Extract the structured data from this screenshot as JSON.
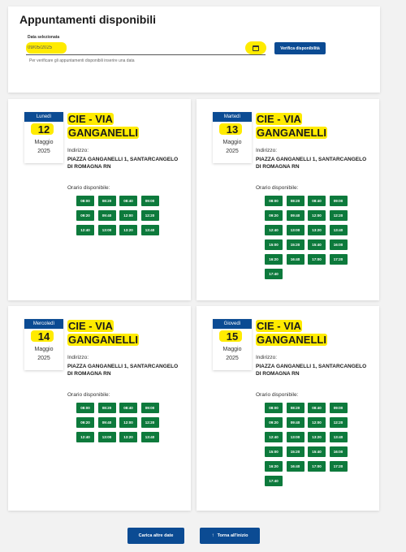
{
  "header": {
    "title": "Appuntamenti disponibili",
    "date_label": "Data selezionata",
    "date_value": "09/05/2025",
    "verify_label": "Verifica disponibilità",
    "hint": "Per verificare gli appuntamenti disponibili inserire una data"
  },
  "cards": [
    {
      "weekday": "Lunedì",
      "day": "12",
      "month": "Maggio",
      "year": "2025",
      "name_line1": "CIE - VIA",
      "name_line2": "GANGANELLI",
      "address_label": "Indirizzo:",
      "address": "PIAZZA GANGANELLI 1, SANTARCANGELO DI ROMAGNA RN",
      "time_label": "Orario disponibile:",
      "slots": [
        "08:00",
        "08:20",
        "08:40",
        "09:00",
        "09:20",
        "09:40",
        "12:00",
        "12:20",
        "12:40",
        "13:00",
        "13:20",
        "13:40"
      ]
    },
    {
      "weekday": "Martedì",
      "day": "13",
      "month": "Maggio",
      "year": "2025",
      "name_line1": "CIE - VIA",
      "name_line2": "GANGANELLI",
      "address_label": "Indirizzo:",
      "address": "PIAZZA GANGANELLI 1, SANTARCANGELO DI ROMAGNA RN",
      "time_label": "Orario disponibile:",
      "slots": [
        "08:00",
        "08:20",
        "08:40",
        "09:00",
        "09:20",
        "09:40",
        "12:00",
        "12:20",
        "12:40",
        "13:00",
        "13:20",
        "13:40",
        "15:00",
        "15:20",
        "15:40",
        "16:00",
        "16:20",
        "16:40",
        "17:00",
        "17:20",
        "17:40"
      ]
    },
    {
      "weekday": "Mercoledì",
      "day": "14",
      "month": "Maggio",
      "year": "2025",
      "name_line1": "CIE - VIA",
      "name_line2": "GANGANELLI",
      "address_label": "Indirizzo:",
      "address": "PIAZZA GANGANELLI 1, SANTARCANGELO DI ROMAGNA RN",
      "time_label": "Orario disponibile:",
      "slots": [
        "08:00",
        "08:20",
        "08:40",
        "09:00",
        "09:20",
        "09:40",
        "12:00",
        "12:20",
        "12:40",
        "13:00",
        "13:20",
        "13:40"
      ]
    },
    {
      "weekday": "Giovedì",
      "day": "15",
      "month": "Maggio",
      "year": "2025",
      "name_line1": "CIE - VIA",
      "name_line2": "GANGANELLI",
      "address_label": "Indirizzo:",
      "address": "PIAZZA GANGANELLI 1, SANTARCANGELO DI ROMAGNA RN",
      "time_label": "Orario disponibile:",
      "slots": [
        "08:00",
        "08:20",
        "08:40",
        "09:00",
        "09:20",
        "09:40",
        "12:00",
        "12:20",
        "12:40",
        "13:00",
        "13:20",
        "13:40",
        "15:00",
        "15:20",
        "15:40",
        "16:00",
        "16:20",
        "16:40",
        "17:00",
        "17:20",
        "17:40"
      ]
    }
  ],
  "footer": {
    "load_more_label": "Carica altre date",
    "back_top_label": "Torna all'inizio",
    "back_top_icon": "arrow-up-icon"
  },
  "colors": {
    "primary": "#0b4b93",
    "slot": "#0d7a3c",
    "highlight": "#ffeb00"
  }
}
